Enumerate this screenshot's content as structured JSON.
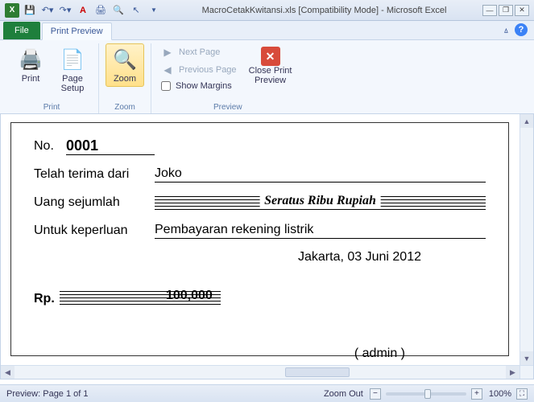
{
  "window": {
    "title": "MacroCetakKwitansi.xls  [Compatibility Mode] - Microsoft Excel"
  },
  "tabs": {
    "file": "File",
    "print_preview": "Print Preview"
  },
  "ribbon": {
    "print": {
      "print": "Print",
      "page_setup": "Page\nSetup",
      "group_label": "Print"
    },
    "zoom": {
      "zoom": "Zoom",
      "group_label": "Zoom"
    },
    "preview": {
      "next_page": "Next Page",
      "previous_page": "Previous Page",
      "show_margins": "Show Margins",
      "close": "Close Print\nPreview",
      "group_label": "Preview"
    }
  },
  "receipt": {
    "no_label": "No.",
    "no_value": "0001",
    "received_from_label": "Telah terima dari",
    "received_from_value": "Joko",
    "amount_label": "Uang sejumlah",
    "amount_words": "Seratus Ribu Rupiah",
    "for_label": "Untuk keperluan",
    "for_value": "Pembayaran rekening listrik",
    "place_date": "Jakarta, 03 Juni 2012",
    "currency_label": "Rp.",
    "amount_number": "100,000",
    "signer": "( admin )"
  },
  "status": {
    "page_info": "Preview: Page 1 of 1",
    "zoom_out": "Zoom Out",
    "zoom_pct": "100%"
  }
}
